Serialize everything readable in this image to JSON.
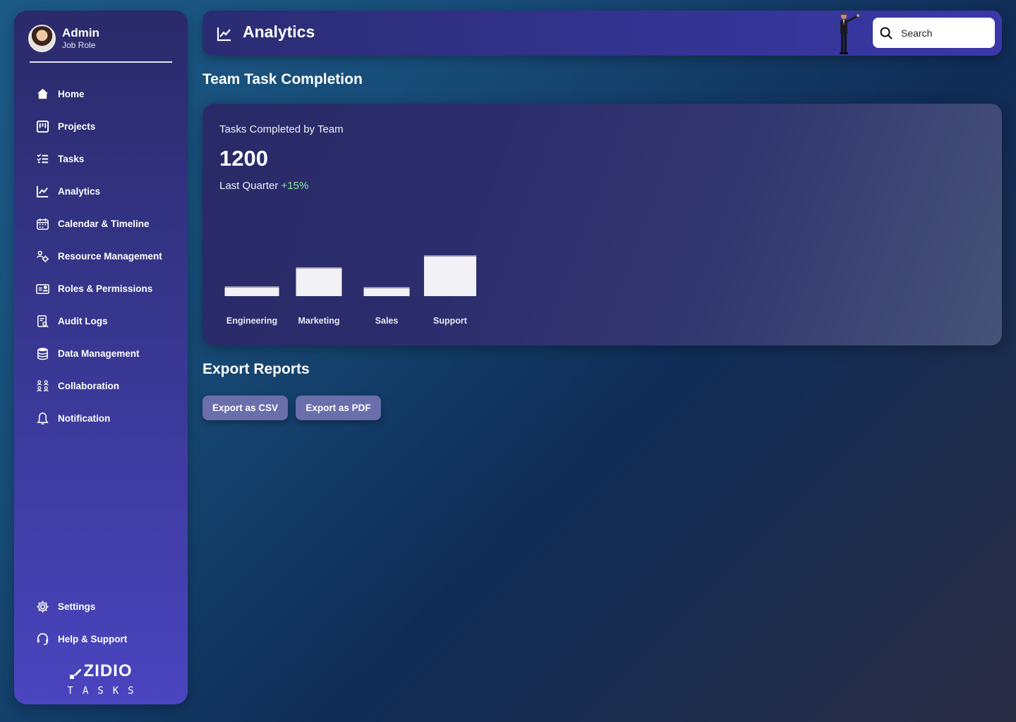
{
  "profile": {
    "name": "Admin",
    "role": "Job Role"
  },
  "sidebar": {
    "items": [
      {
        "label": "Home",
        "icon": "home-icon"
      },
      {
        "label": "Projects",
        "icon": "projects-icon"
      },
      {
        "label": "Tasks",
        "icon": "tasks-icon"
      },
      {
        "label": "Analytics",
        "icon": "analytics-icon"
      },
      {
        "label": "Calendar & Timeline",
        "icon": "calendar-icon"
      },
      {
        "label": "Resource Management",
        "icon": "resource-icon"
      },
      {
        "label": "Roles & Permissions",
        "icon": "roles-icon"
      },
      {
        "label": "Audit Logs",
        "icon": "audit-icon"
      },
      {
        "label": "Data Management",
        "icon": "database-icon"
      },
      {
        "label": "Collaboration",
        "icon": "collaboration-icon"
      },
      {
        "label": "Notification",
        "icon": "bell-icon"
      }
    ],
    "bottom_items": [
      {
        "label": "Settings",
        "icon": "gear-icon"
      },
      {
        "label": "Help & Support",
        "icon": "headset-icon"
      }
    ]
  },
  "brand": {
    "name": "ZIDIO",
    "tagline": "TASKS"
  },
  "header": {
    "title": "Analytics",
    "search_placeholder": "Search"
  },
  "main": {
    "section_title": "Team Task Completion",
    "card": {
      "label": "Tasks Completed by Team",
      "value": "1200",
      "period": "Last Quarter",
      "change": "+15%"
    },
    "export_title": "Export Reports",
    "export_csv": "Export as CSV",
    "export_pdf": "Export as PDF"
  },
  "colors": {
    "accent": "#3a38a8",
    "bar": "#f1f1f6",
    "positive": "#8ee3a3",
    "button": "#6a6eab"
  },
  "chart_data": {
    "type": "bar",
    "categories": [
      "Engineering",
      "Marketing",
      "Sales",
      "Support"
    ],
    "values": [
      14,
      41,
      13,
      58
    ],
    "ylim": [
      0,
      100
    ],
    "title": "",
    "xlabel": "",
    "ylabel": "",
    "grid": false,
    "legend": "none"
  }
}
